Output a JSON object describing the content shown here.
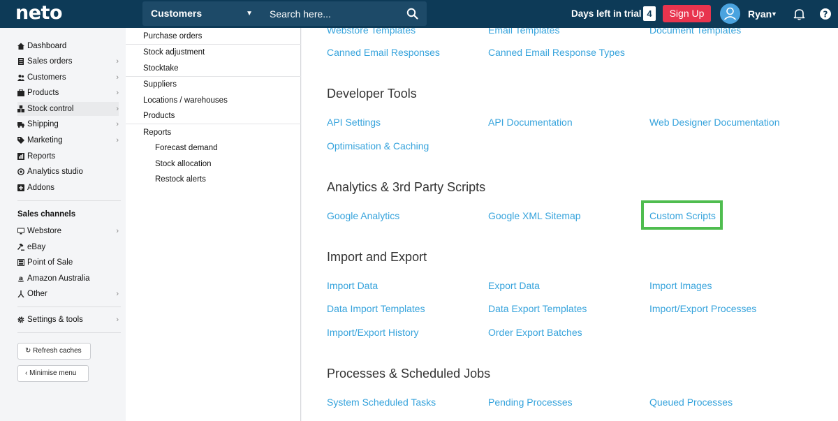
{
  "topbar": {
    "logo": "neto",
    "section_select": "Customers",
    "search_placeholder": "Search here...",
    "trial_text": "Days left in trial",
    "trial_days": "4",
    "signup_label": "Sign Up",
    "user_name": "Ryan",
    "colors": {
      "bar": "#0d3a57",
      "signup": "#e8344e",
      "avatar": "#4aa3df"
    }
  },
  "leftnav": {
    "items": [
      {
        "label": "Dashboard",
        "icon": "home-icon",
        "chevron": false
      },
      {
        "label": "Sales orders",
        "icon": "receipt-icon",
        "chevron": true
      },
      {
        "label": "Customers",
        "icon": "users-icon",
        "chevron": true
      },
      {
        "label": "Products",
        "icon": "products-icon",
        "chevron": true
      },
      {
        "label": "Stock control",
        "icon": "stock-icon",
        "chevron": true
      },
      {
        "label": "Shipping",
        "icon": "truck-icon",
        "chevron": true
      },
      {
        "label": "Marketing",
        "icon": "tag-icon",
        "chevron": true
      },
      {
        "label": "Reports",
        "icon": "chart-icon",
        "chevron": false
      },
      {
        "label": "Analytics studio",
        "icon": "analytics-icon",
        "chevron": false
      },
      {
        "label": "Addons",
        "icon": "plus-box-icon",
        "chevron": false
      }
    ],
    "channels_heading": "Sales channels",
    "channels": [
      {
        "label": "Webstore",
        "icon": "monitor-icon",
        "chevron": true
      },
      {
        "label": "eBay",
        "icon": "gavel-icon",
        "chevron": false
      },
      {
        "label": "Point of Sale",
        "icon": "pos-icon",
        "chevron": false
      },
      {
        "label": "Amazon Australia",
        "icon": "amazon-icon",
        "chevron": false
      },
      {
        "label": "Other",
        "icon": "branch-icon",
        "chevron": true
      }
    ],
    "settings": {
      "label": "Settings & tools",
      "icon": "gear-icon"
    },
    "refresh_label": "Refresh caches",
    "minimise_label": "Minimise menu"
  },
  "submenu": {
    "items": [
      "Purchase orders",
      "Stock adjustment",
      "Stocktake",
      "Suppliers",
      "Locations / warehouses",
      "Products",
      "Reports"
    ],
    "report_items": [
      "Forecast demand",
      "Stock allocation",
      "Restock alerts"
    ]
  },
  "main": {
    "top_links": {
      "partial": [
        "Webstore Templates",
        "Email Templates",
        "Document Templates"
      ],
      "row": [
        "Canned Email Responses",
        "Canned Email Response Types"
      ]
    },
    "sections": [
      {
        "title": "Developer Tools",
        "links": [
          "API Settings",
          "API Documentation",
          "Web Designer Documentation",
          "Optimisation & Caching"
        ]
      },
      {
        "title": "Analytics & 3rd Party Scripts",
        "links": [
          "Google Analytics",
          "Google XML Sitemap",
          "Custom Scripts"
        ]
      },
      {
        "title": "Import and Export",
        "links": [
          "Import Data",
          "Export Data",
          "Import Images",
          "Data Import Templates",
          "Data Export Templates",
          "Import/Export Processes",
          "Import/Export History",
          "Order Export Batches"
        ]
      },
      {
        "title": "Processes & Scheduled Jobs",
        "links": [
          "System Scheduled Tasks",
          "Pending Processes",
          "Queued Processes"
        ]
      }
    ],
    "link_color": "#36a3dc",
    "highlight_color": "#4fbd4f"
  }
}
